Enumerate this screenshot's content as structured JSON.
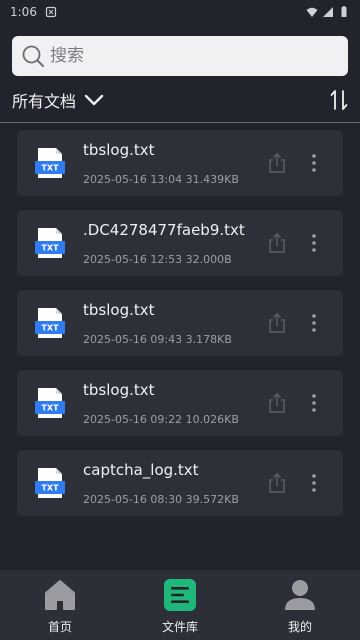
{
  "status_bar": {
    "time": "1:06",
    "notif_icon": "notification-icon",
    "wifi_icon": "wifi-icon",
    "signal_icon": "signal-icon",
    "battery_icon": "battery-icon"
  },
  "search": {
    "placeholder": "搜索",
    "icon": "search-icon"
  },
  "filter": {
    "label": "所有文档",
    "dropdown_icon": "chevron-down-icon",
    "sort_icon": "sort-icon"
  },
  "files": [
    {
      "name": "tbslog.txt",
      "date": "2025-05-16 13:04",
      "size": "31.439KB",
      "type": "TXT"
    },
    {
      "name": ".DC4278477faeb9.txt",
      "date": "2025-05-16 12:53",
      "size": "32.000B",
      "type": "TXT"
    },
    {
      "name": "tbslog.txt",
      "date": "2025-05-16 09:43",
      "size": "3.178KB",
      "type": "TXT"
    },
    {
      "name": "tbslog.txt",
      "date": "2025-05-16 09:22",
      "size": "10.026KB",
      "type": "TXT"
    },
    {
      "name": "captcha_log.txt",
      "date": "2025-05-16 08:30",
      "size": "39.572KB",
      "type": "TXT"
    }
  ],
  "nav": [
    {
      "label": "首页",
      "icon": "home-icon"
    },
    {
      "label": "文件库",
      "icon": "file-library-icon",
      "active_color": "#1fb87a"
    },
    {
      "label": "我的",
      "icon": "profile-icon"
    }
  ],
  "colors": {
    "accent": "#1fb87a",
    "txt_icon": "#2f7df0",
    "background": "#21242c",
    "card": "#2d3039"
  }
}
